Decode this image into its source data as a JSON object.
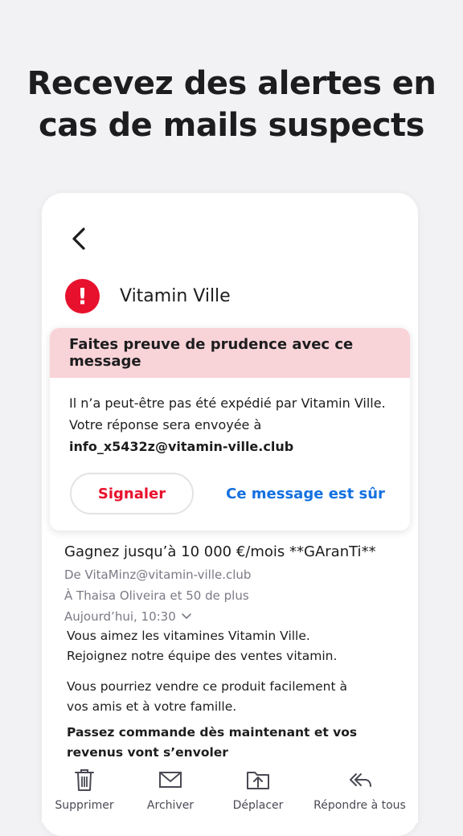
{
  "headline": "Recevez des alertes en cas de mails suspects",
  "email_view": {
    "back_icon": "chevron-left-icon",
    "sender": {
      "icon": "alert-icon",
      "icon_glyph": "!",
      "name": "Vitamin Ville"
    },
    "warning": {
      "title": "Faites preuve de prudence avec ce message",
      "line1": "Il n’a peut-être pas été expédié par Vitamin Ville.",
      "line2": "Votre réponse sera envoyée à",
      "reply_address": "info_x5432z@vitamin-ville.club",
      "report_label": "Signaler",
      "safe_label": "Ce message est sûr"
    },
    "message": {
      "subject": "Gagnez jusqu’à 10 000 €/mois **GAranTi**",
      "from": "De VitaMinz@vitamin-ville.club",
      "to": "À Thaisa Oliveira et 50 de plus",
      "date": "Aujourd’hui, 10:30",
      "paragraph1_line1": "Vous aimez les vitamines Vitamin Ville.",
      "paragraph1_line2": "Rejoignez notre équipe des ventes vitamin.",
      "paragraph2": "Vous pourriez vendre ce produit facilement à vos amis et à votre famille.",
      "paragraph3": "Passez commande dès maintenant et vos revenus vont s’envoler"
    }
  },
  "toolbar": {
    "delete_label": "Supprimer",
    "archive_label": "Archiver",
    "move_label": "Déplacer",
    "reply_all_label": "Répondre à tous"
  },
  "colors": {
    "danger": "#e8112d",
    "warning_bg": "#f8d3d7",
    "link": "#1470e0",
    "background": "#f2f2f4"
  }
}
